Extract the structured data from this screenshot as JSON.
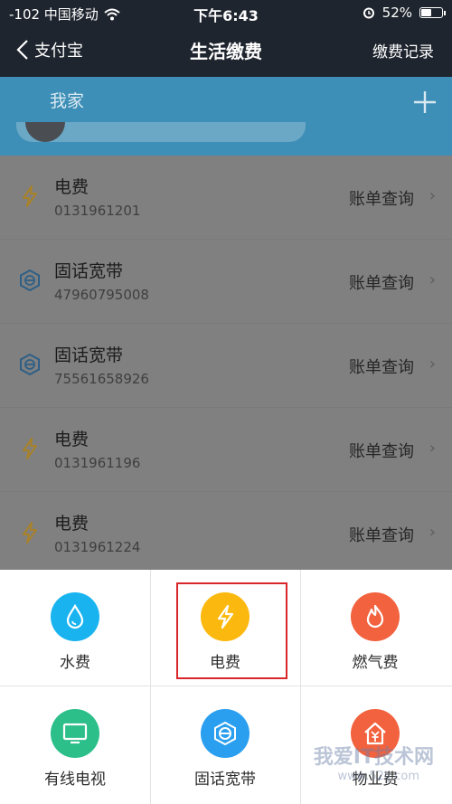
{
  "status_bar": {
    "carrier": "-102 中国移动",
    "time": "下午6:43",
    "battery": "52%",
    "battery_level": 0.52
  },
  "nav": {
    "back_label": "支付宝",
    "title": "生活缴费",
    "right_label": "缴费记录"
  },
  "header": {
    "tab_label": "我家",
    "add_icon": "plus-icon"
  },
  "bills": [
    {
      "name": "电费",
      "account": "0131961201",
      "action": "账单查询",
      "icon": "lightning-icon"
    },
    {
      "name": "固话宽带",
      "account": "47960795008",
      "action": "账单查询",
      "icon": "broadband-icon"
    },
    {
      "name": "固话宽带",
      "account": "75561658926",
      "action": "账单查询",
      "icon": "broadband-icon"
    },
    {
      "name": "电费",
      "account": "0131961196",
      "action": "账单查询",
      "icon": "lightning-icon"
    },
    {
      "name": "电费",
      "account": "0131961224",
      "action": "账单查询",
      "icon": "lightning-icon"
    }
  ],
  "services": [
    {
      "label": "水费",
      "icon": "water-drop-icon",
      "color": "#19b4f0"
    },
    {
      "label": "电费",
      "icon": "lightning-icon",
      "color": "#fbb90f"
    },
    {
      "label": "燃气费",
      "icon": "flame-icon",
      "color": "#f2623e"
    },
    {
      "label": "有线电视",
      "icon": "tv-icon",
      "color": "#2cbf8a"
    },
    {
      "label": "固话宽带",
      "icon": "broadband-icon",
      "color": "#2a9ff0"
    },
    {
      "label": "物业费",
      "icon": "house-yuan-icon",
      "color": "#f2623e"
    }
  ],
  "watermark": {
    "line1": "我爱IT技术网",
    "line2": "www.52ij.com"
  },
  "colors": {
    "nav_bg": "#1f252e",
    "header_bg": "#3e8fb7",
    "list_overlay": "#808080",
    "highlight": "#d8262b"
  }
}
